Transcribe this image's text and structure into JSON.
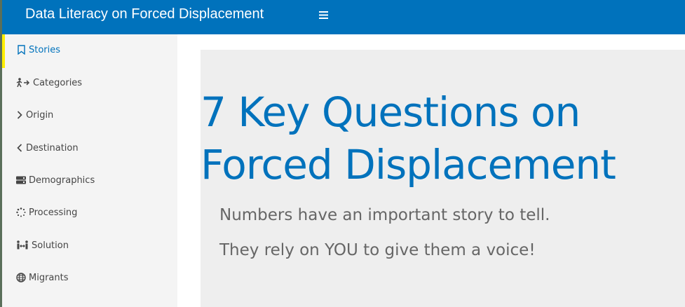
{
  "header": {
    "title": "Data Literacy on Forced Displacement",
    "menu_icon": "hamburger-icon"
  },
  "sidebar": {
    "items": [
      {
        "label": "Stories",
        "icon": "bookmark-icon",
        "active": true
      },
      {
        "label": "Categories",
        "icon": "person-arrow-icon",
        "active": false
      },
      {
        "label": "Origin",
        "icon": "chevron-right-icon",
        "active": false
      },
      {
        "label": "Destination",
        "icon": "chevron-left-icon",
        "active": false
      },
      {
        "label": "Demographics",
        "icon": "server-icon",
        "active": false
      },
      {
        "label": "Processing",
        "icon": "spinner-icon",
        "active": false
      },
      {
        "label": "Solution",
        "icon": "people-arrows-icon",
        "active": false
      },
      {
        "label": "Migrants",
        "icon": "globe-icon",
        "active": false
      }
    ]
  },
  "main": {
    "heading_line1": "7 Key Questions on",
    "heading_line2": "Forced Displacement",
    "subtitle1": "Numbers have an important story to tell.",
    "subtitle2": "They rely on YOU to give them a voice!"
  },
  "colors": {
    "brand_blue": "#0072bc",
    "active_marker": "#ffee00",
    "sidebar_bg": "#f4f4f4",
    "panel_bg": "#eeeeee"
  }
}
